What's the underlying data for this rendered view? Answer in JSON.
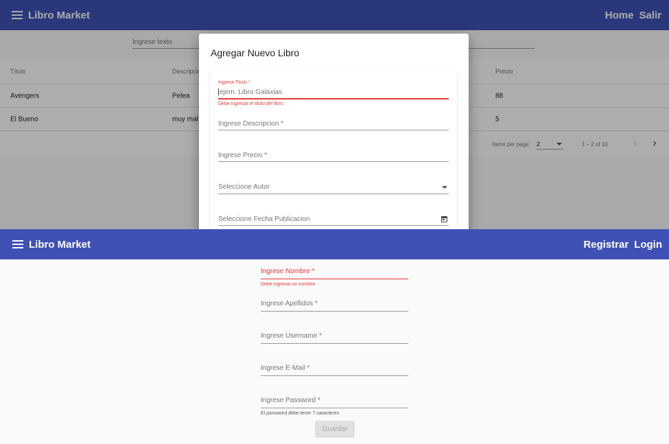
{
  "app": {
    "brand": "Libro Market"
  },
  "top_panel": {
    "nav": {
      "home": "Home",
      "logout": "Salir"
    },
    "filter": {
      "placeholder": "Ingrese texto"
    },
    "table": {
      "headers": [
        "Título",
        "Descripción",
        "Precio"
      ],
      "rows": [
        {
          "title": "Avengers",
          "description": "Pelea",
          "price": "88"
        },
        {
          "title": "El Bueno",
          "description": "muy mal",
          "price": "5"
        }
      ]
    },
    "paginator": {
      "items_per_page_label": "Items per page:",
      "page_size": "2",
      "range": "1 – 2 of 10"
    },
    "dialog": {
      "title": "Agregar Nuevo Libro",
      "fields": {
        "titulo": {
          "label": "Ingrese Titulo *",
          "placeholder": "ejem. Libro Galaxias",
          "error": "Debe ingresar el titulo del libro"
        },
        "descripcion": {
          "label": "Ingrese Descripcion *"
        },
        "precio": {
          "label": "Ingrese Precio *"
        },
        "autor": {
          "label": "Seleccione Autor"
        },
        "fecha": {
          "label": "Seleccione Fecha Publicacion"
        }
      }
    }
  },
  "bottom_panel": {
    "nav": {
      "register": "Registrar",
      "login": "Login"
    },
    "form": {
      "nombre": {
        "label": "Ingrese Nombre *",
        "error": "Debe ingresar un nombre"
      },
      "apellidos": {
        "label": "Ingrese Apellidos *"
      },
      "username": {
        "label": "Ingrese Username *"
      },
      "email": {
        "label": "Ingrese E-Mail *"
      },
      "password": {
        "label": "Ingrese Password *",
        "hint": "El password debe tener 7 caracteres"
      },
      "save_label": "Guardar"
    }
  },
  "colors": {
    "primary": "#3f51b5",
    "error": "#e53935"
  },
  "icons": {
    "menu": "menu-icon",
    "prev": "chevron-left-icon",
    "next": "chevron-right-icon",
    "dropdown": "arrow-drop-down-icon",
    "calendar": "calendar-icon"
  }
}
